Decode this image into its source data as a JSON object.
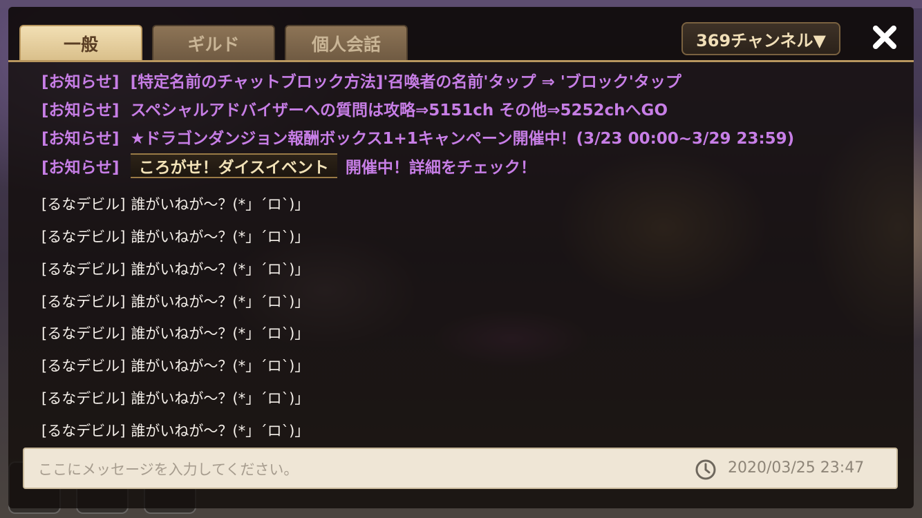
{
  "tabs": [
    {
      "label": "一般",
      "active": true
    },
    {
      "label": "ギルド",
      "active": false
    },
    {
      "label": "個人会話",
      "active": false
    }
  ],
  "channel": {
    "label": "369チャンネル▼"
  },
  "close": {
    "icon": "close-icon",
    "glyph": "✕"
  },
  "notices": [
    {
      "prefix": "[お知らせ]",
      "text": "[特定名前のチャットブロック方法]'召喚者の名前'タップ ⇒ 'ブロック'タップ"
    },
    {
      "prefix": "[お知らせ]",
      "text": "スペシャルアドバイザーへの質問は攻略⇒5151ch その他⇒5252chへGO"
    },
    {
      "prefix": "[お知らせ]",
      "text": "★ドラゴンダンジョン報酬ボックス1+1キャンペーン開催中！(3/23 00:00~3/29 23:59)"
    },
    {
      "prefix": "[お知らせ]",
      "badge": "ころがせ！ダイスイベント",
      "text": "開催中！詳細をチェック！"
    }
  ],
  "messages": [
    {
      "sender": "[るなデビル]",
      "text": "誰がいねが～？(*」´ロ`)」"
    },
    {
      "sender": "[るなデビル]",
      "text": "誰がいねが～？(*」´ロ`)」"
    },
    {
      "sender": "[るなデビル]",
      "text": "誰がいねが～？(*」´ロ`)」"
    },
    {
      "sender": "[るなデビル]",
      "text": "誰がいねが～？(*」´ロ`)」"
    },
    {
      "sender": "[るなデビル]",
      "text": "誰がいねが～？(*」´ロ`)」"
    },
    {
      "sender": "[るなデビル]",
      "text": "誰がいねが～？(*」´ロ`)」"
    },
    {
      "sender": "[るなデビル]",
      "text": "誰がいねが～？(*」´ロ`)」"
    },
    {
      "sender": "[るなデビル]",
      "text": "誰がいねが～？(*」´ロ`)」"
    }
  ],
  "input": {
    "placeholder": "ここにメッセージを入力してください。",
    "timestamp": "2020/03/25 23:47",
    "clock_icon": "clock-icon"
  },
  "colors": {
    "notice": "#c77ee6",
    "message": "#f5f0ea",
    "tab_active": "#d9bf8a",
    "tab_inactive": "#7d6648"
  }
}
